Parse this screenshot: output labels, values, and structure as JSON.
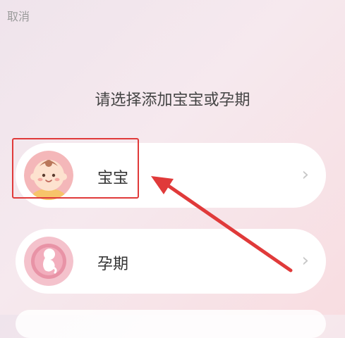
{
  "header": {
    "cancel_label": "取消"
  },
  "prompt": {
    "title": "请选择添加宝宝或孕期"
  },
  "options": [
    {
      "label": "宝宝",
      "icon": "baby-face-icon"
    },
    {
      "label": "孕期",
      "icon": "fetus-icon"
    }
  ],
  "annotation": {
    "highlight_color": "#e03a3a"
  },
  "colors": {
    "accent": "#e03a3a",
    "card_bg": "#ffffff"
  }
}
